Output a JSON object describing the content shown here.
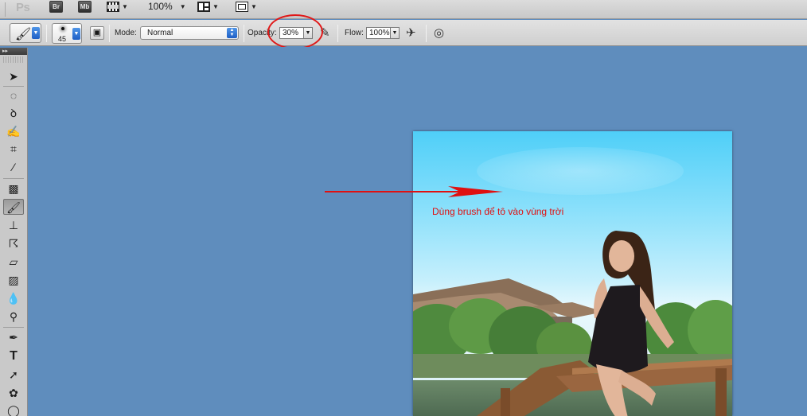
{
  "app_bar": {
    "logo": "Ps",
    "bridge_label": "Br",
    "minibridge_label": "Mb",
    "zoom": "100%"
  },
  "options_bar": {
    "brush_size": "45",
    "mode_label": "Mode:",
    "mode_value": "Normal",
    "opacity_label": "Opacity:",
    "opacity_value": "30%",
    "flow_label": "Flow:",
    "flow_value": "100%"
  },
  "tools": [
    {
      "name": "move-tool",
      "icon": "move-icon"
    },
    {
      "name": "marquee-tool",
      "icon": "ellipse-marquee-icon"
    },
    {
      "name": "lasso-tool",
      "icon": "lasso-icon"
    },
    {
      "name": "quick-selection-tool",
      "icon": "quick-selection-icon"
    },
    {
      "name": "crop-tool",
      "icon": "crop-icon"
    },
    {
      "name": "eyedropper-tool",
      "icon": "eyedropper-icon"
    },
    {
      "name": "healing-brush-tool",
      "icon": "bandage-icon"
    },
    {
      "name": "brush-tool",
      "icon": "brush-icon",
      "active": true
    },
    {
      "name": "clone-stamp-tool",
      "icon": "stamp-icon"
    },
    {
      "name": "history-brush-tool",
      "icon": "history-brush-icon"
    },
    {
      "name": "eraser-tool",
      "icon": "eraser-icon"
    },
    {
      "name": "gradient-tool",
      "icon": "gradient-icon"
    },
    {
      "name": "blur-tool",
      "icon": "drop-icon"
    },
    {
      "name": "dodge-tool",
      "icon": "dodge-icon"
    },
    {
      "name": "pen-tool",
      "icon": "pen-icon"
    },
    {
      "name": "type-tool",
      "icon": "type-icon",
      "glyph": "T"
    },
    {
      "name": "path-selection-tool",
      "icon": "arrow-select-icon"
    },
    {
      "name": "custom-shape-tool",
      "icon": "shape-icon"
    },
    {
      "name": "3d-rotate-tool",
      "icon": "3d-rotate-icon"
    }
  ],
  "annotation": {
    "text": "Dùng brush để tô vào vùng trời",
    "color": "#e01010"
  },
  "colors": {
    "workspace": "#5f8dbd",
    "highlight": "#e01818"
  }
}
